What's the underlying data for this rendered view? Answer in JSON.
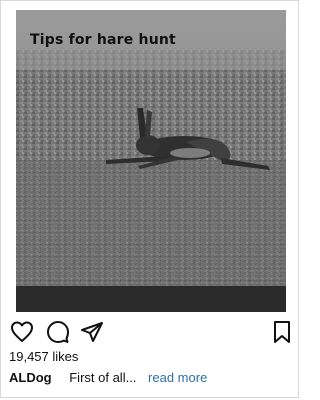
{
  "post": {
    "image_overlay_title": "Tips for hare hunt",
    "image_subject": "hare running across a field (black and white photo)",
    "likes_text": "19,457 likes",
    "username": "ALDog",
    "caption_preview": "First of all...",
    "read_more_label": "read more"
  },
  "actions": {
    "like_icon": "heart-outline-icon",
    "comment_icon": "comment-bubble-icon",
    "share_icon": "paper-plane-icon",
    "save_icon": "bookmark-icon"
  },
  "colors": {
    "link": "#2f6fa7",
    "text": "#111111",
    "background": "#ffffff"
  }
}
